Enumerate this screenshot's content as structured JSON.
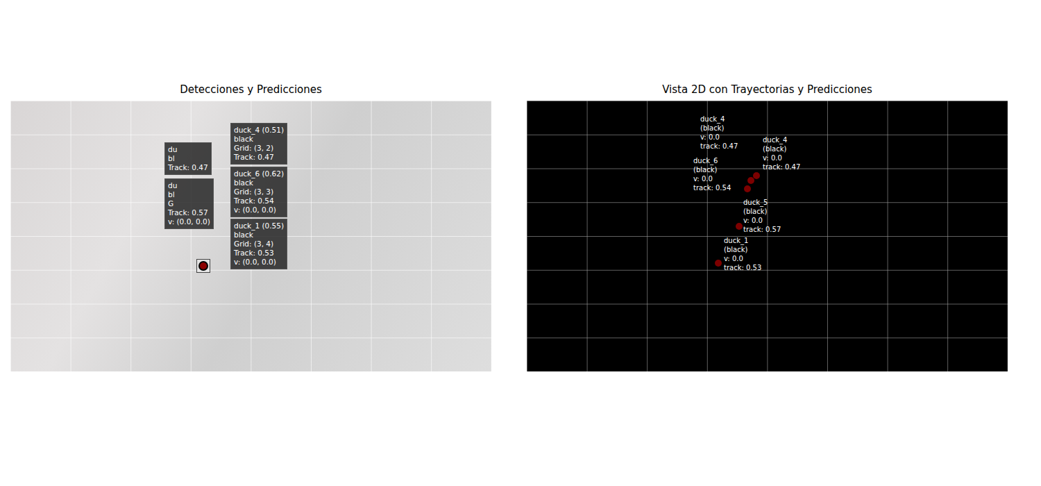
{
  "figure": {
    "left": {
      "title": "Detecciones y Predicciones",
      "labels": [
        {
          "lines": [
            "duck_4 (0.51)",
            "black",
            "Grid: (3, 2)",
            "Track: 0.47"
          ],
          "marker": false
        },
        {
          "lines": [
            "du",
            "bl",
            "Track: 0.47"
          ],
          "marker": false
        },
        {
          "lines": [
            "duck_6 (0.62)",
            "black",
            "Grid: (3, 3)",
            "Track: 0.54",
            "v: (0.0, 0.0)"
          ],
          "marker": false
        },
        {
          "lines": [
            "du",
            "bl",
            "G",
            "Track: 0.57",
            "v: (0.0, 0.0)"
          ],
          "marker": false
        },
        {
          "lines": [
            "duck_1 (0.55)",
            "black",
            "Grid: (3, 4)",
            "Track: 0.53",
            "v: (0.0, 0.0)"
          ],
          "marker": true
        }
      ]
    },
    "right": {
      "title": "Vista 2D con Trayectorias y Predicciones",
      "points": [
        {
          "lines": [
            "duck_4",
            "(black)",
            "v: 0.0",
            "track: 0.47"
          ],
          "x": 3.82,
          "y": 2.22,
          "color": "#8b0000"
        },
        {
          "lines": [
            "duck_4",
            "(black)",
            "v: 0.0",
            "track: 0.47"
          ],
          "x": 3.73,
          "y": 2.36,
          "color": "#8b0000"
        },
        {
          "lines": [
            "duck_6",
            "(black)",
            "v: 0.0",
            "track: 0.54"
          ],
          "x": 3.67,
          "y": 2.6,
          "color": "#8b0000"
        },
        {
          "lines": [
            "duck_5",
            "(black)",
            "v: 0.0",
            "track: 0.57"
          ],
          "x": 3.53,
          "y": 3.71,
          "color": "#8b0000"
        },
        {
          "lines": [
            "duck_1",
            "(black)",
            "v: 0.0",
            "track: 0.53"
          ],
          "x": 3.19,
          "y": 4.8,
          "color": "#8b0000"
        }
      ]
    }
  }
}
